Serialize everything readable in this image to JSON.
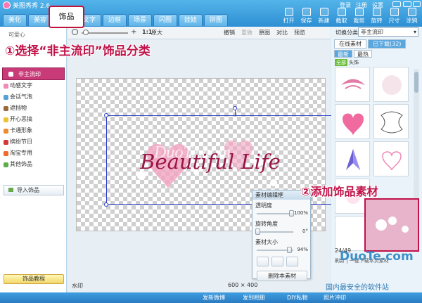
{
  "app": {
    "title": "美图秀秀 2.6"
  },
  "tabs": [
    "美化",
    "美容",
    "饰品",
    "文字",
    "边框",
    "场景",
    "闪图",
    "娃娃",
    "拼图"
  ],
  "active_tab": "饰品",
  "user": {
    "links": [
      "登录",
      "注册",
      "设置"
    ]
  },
  "toolbar": [
    "打开",
    "保存",
    "新建",
    "截取",
    "裁剪",
    "旋转",
    "尺寸",
    "涂鸦",
    "撤销"
  ],
  "left": {
    "top_label": "可爱心",
    "categories": [
      {
        "label": "非主流印",
        "color": "#c93a78"
      },
      {
        "label": "动感文字",
        "color": "#f08ab6"
      },
      {
        "label": "会话气泡",
        "color": "#56a0d8"
      },
      {
        "label": "遮挡物",
        "color": "#9a6b3a"
      },
      {
        "label": "开心恶搞",
        "color": "#f0c232"
      },
      {
        "label": "卡通形象",
        "color": "#f08a32"
      },
      {
        "label": "缤纷节日",
        "color": "#d23a3a"
      },
      {
        "label": "淘宝专用",
        "color": "#f06a2a"
      },
      {
        "label": "其他饰品",
        "color": "#5cae4a"
      }
    ],
    "import_label": "导入饰品",
    "tutorial_label": "饰品教程"
  },
  "annotations": {
    "step1": "①选择“非主流印”饰品分类",
    "step2": "②添加饰品素材"
  },
  "zoom": {
    "ratio": "1:1",
    "orig": "原大"
  },
  "edit": {
    "undo": "撤销",
    "redo": "重做",
    "original": "原图",
    "compare": "对比",
    "preview": "预览"
  },
  "canvas": {
    "art_text": "Beautiful Life",
    "watermark": "DuoTe.com"
  },
  "editor": {
    "title": "素材编辑框",
    "opacity_label": "透明度",
    "opacity_value": "100%",
    "opacity": 1.0,
    "rotate_label": "旋转角度",
    "rotate_value": "0°",
    "rotate": 0.0,
    "size_label": "素材大小",
    "size_value": "94%",
    "size": 0.94,
    "delete_label": "删除本素材"
  },
  "status": {
    "watermark_label": "水印",
    "dimensions": "600 × 400"
  },
  "right": {
    "header": "切换分类",
    "dropdown": "非主流印",
    "tab_online": "在线素材",
    "tab_downloaded": "已下载(32)",
    "sub_latest": "最新",
    "sub_hot": "最热",
    "cat_all": "全部",
    "cat_head": "头饰",
    "pager": "24/49",
    "footer": "刷新 | 一键下载本页素材"
  },
  "brand": {
    "name": "DuoTe.com",
    "sub": "国内最安全的软件站"
  },
  "statusbar": [
    "发新微博",
    "发到相册",
    "DIY私物",
    "照片冲印"
  ]
}
